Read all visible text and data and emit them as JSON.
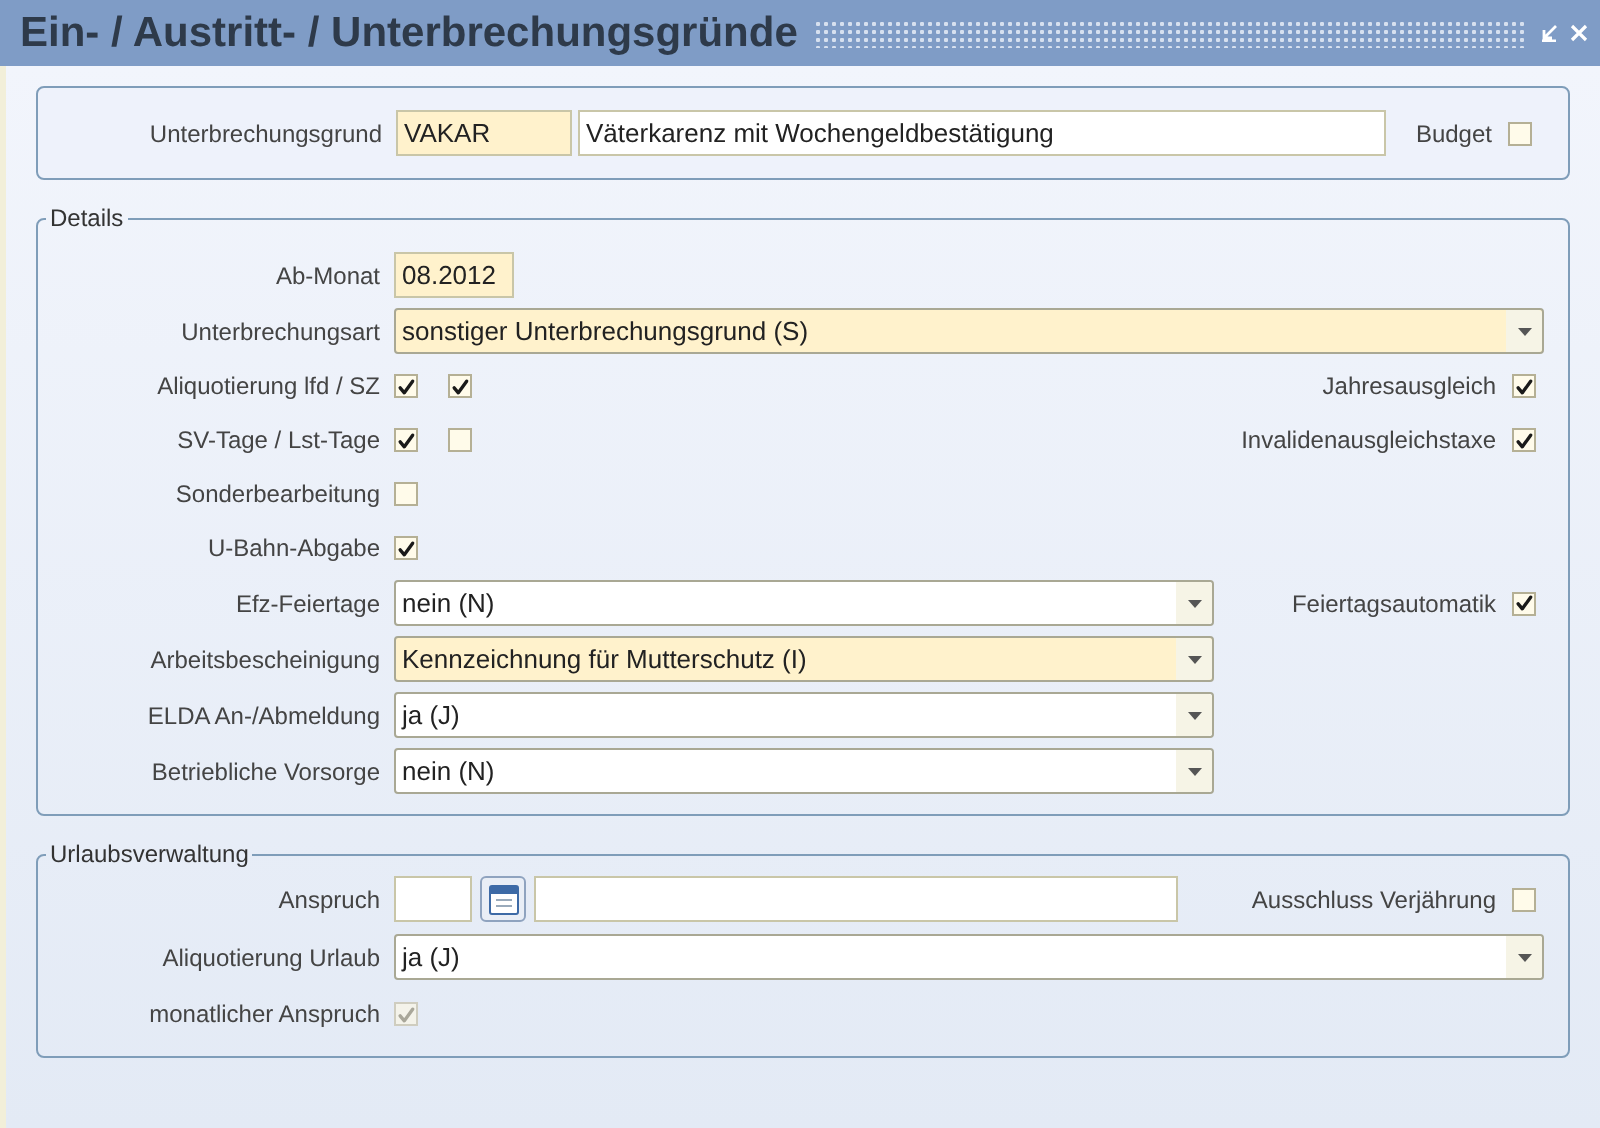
{
  "window": {
    "title": "Ein- / Austritt- / Unterbrechungsgründe"
  },
  "header": {
    "label": "Unterbrechungsgrund",
    "code": {
      "value": "VAKAR",
      "required": true
    },
    "description": {
      "value": "Väterkarenz mit Wochengeldbestätigung",
      "required": false
    },
    "right": {
      "label": "Budget",
      "checked": false
    }
  },
  "sections": [
    {
      "legend": "Details",
      "rows": [
        {
          "kind": "field",
          "label": "Ab-Monat",
          "value": "08.2012",
          "required": true
        },
        {
          "kind": "select",
          "label": "Unterbrechungsart",
          "value": "sonstiger Unterbrechungsgrund (S)",
          "required": true
        },
        {
          "kind": "checks",
          "label": "Aliquotierung lfd / SZ",
          "checks": [
            {
              "checked": true
            },
            {
              "checked": true
            }
          ],
          "right": {
            "label": "Jahresausgleich",
            "checked": true
          }
        },
        {
          "kind": "checks",
          "label": "SV-Tage / Lst-Tage",
          "checks": [
            {
              "checked": true
            },
            {
              "checked": false
            }
          ],
          "right": {
            "label": "Invalidenausgleichstaxe",
            "checked": true
          }
        },
        {
          "kind": "checks",
          "label": "Sonderbearbeitung",
          "checks": [
            {
              "checked": false
            }
          ]
        },
        {
          "kind": "checks",
          "label": "U-Bahn-Abgabe",
          "checks": [
            {
              "checked": true
            }
          ]
        },
        {
          "kind": "half_select",
          "label": "Efz-Feiertage",
          "value": "nein (N)",
          "required": false,
          "right": {
            "label": "Feiertagsautomatik",
            "checked": true
          }
        },
        {
          "kind": "half_select",
          "label": "Arbeitsbescheinigung",
          "value": "Kennzeichnung für Mutterschutz (I)",
          "required": true
        },
        {
          "kind": "half_select",
          "label": "ELDA An-/Abmeldung",
          "value": "ja (J)",
          "required": false
        },
        {
          "kind": "half_select",
          "label": "Betriebliche Vorsorge",
          "value": "nein (N)",
          "required": false
        }
      ]
    },
    {
      "legend": "Urlaubsverwaltung",
      "rows": [
        {
          "kind": "anspruch",
          "label": "Anspruch",
          "right": {
            "label": "Ausschluss Verjährung",
            "checked": false
          }
        },
        {
          "kind": "select",
          "label": "Aliquotierung Urlaub",
          "value": "ja (J)",
          "required": false
        },
        {
          "kind": "checks",
          "label": "monatlicher Anspruch",
          "checks": [
            {
              "checked": true,
              "disabled": true
            }
          ]
        }
      ]
    }
  ]
}
